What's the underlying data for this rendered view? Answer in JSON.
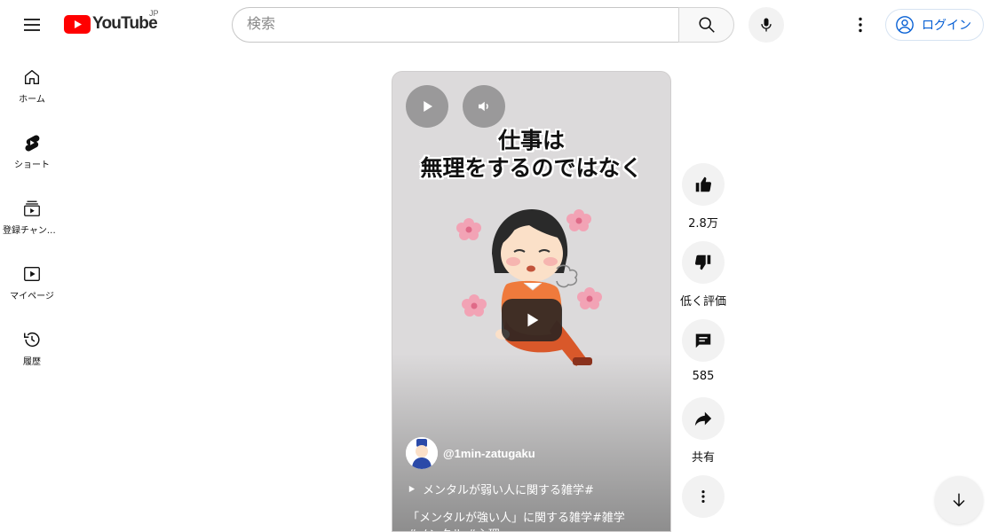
{
  "header": {
    "logo_text": "YouTube",
    "region": "JP",
    "search_placeholder": "検索",
    "login_label": "ログイン"
  },
  "sidebar": {
    "items": [
      {
        "label": "ホーム",
        "icon": "home-icon"
      },
      {
        "label": "ショート",
        "icon": "shorts-icon"
      },
      {
        "label": "登録チャンネル",
        "icon": "subscriptions-icon"
      },
      {
        "label": "マイページ",
        "icon": "library-icon"
      },
      {
        "label": "履歴",
        "icon": "history-icon"
      }
    ]
  },
  "short": {
    "caption_line1": "仕事は",
    "caption_line2": "無理をするのではなく",
    "channel_handle": "@1min-zatugaku",
    "playlist_title": "メンタルが弱い人に関する雑学#",
    "description_line1": "「メンタルが強い人」に関する雑学#雑学",
    "description_line2": "#メンタル #心理"
  },
  "actions": {
    "like_count": "2.8万",
    "dislike_label": "低く評価",
    "comment_count": "585",
    "share_label": "共有"
  },
  "colors": {
    "brand_red": "#ff0000",
    "link_blue": "#065fd4",
    "button_bg": "#f2f2f2"
  }
}
